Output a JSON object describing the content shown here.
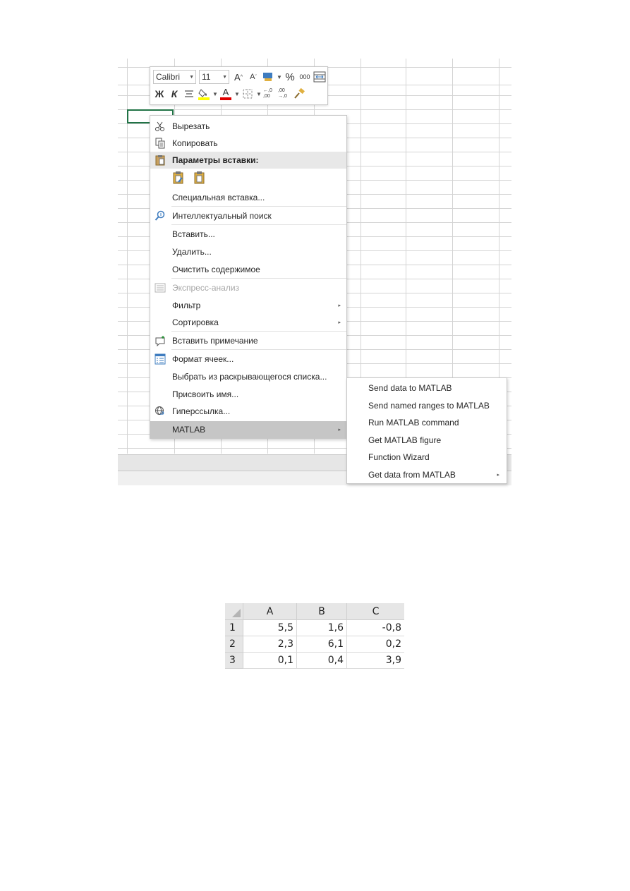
{
  "mini_toolbar": {
    "font_name": "Calibri",
    "font_size": "11",
    "grow_font": "A",
    "shrink_font": "A",
    "percent": "%",
    "thousands": "000",
    "bold": "Ж",
    "italic": "К",
    "font_color_letter": "A",
    "inc_decimal": "←,0 ,00",
    "dec_decimal": ",00 →,0",
    "icons": [
      "font-grow-icon",
      "font-shrink-icon",
      "accounting-format-icon",
      "percent-icon",
      "comma-style-icon",
      "merge-center-icon",
      "bold-icon",
      "italic-icon",
      "align-center-icon",
      "fill-color-icon",
      "font-color-icon",
      "borders-icon",
      "increase-decimal-icon",
      "decrease-decimal-icon",
      "format-painter-icon"
    ],
    "colors": {
      "fill_color": "#ffff00",
      "font_color": "#e00000"
    }
  },
  "context_menu": {
    "cut": "Вырезать",
    "copy": "Копировать",
    "paste_options": "Параметры вставки:",
    "paste_special": "Специальная вставка...",
    "smart_lookup": "Интеллектуальный поиск",
    "insert": "Вставить...",
    "delete": "Удалить...",
    "clear_contents": "Очистить содержимое",
    "quick_analysis": "Экспресс-анализ",
    "filter": "Фильтр",
    "sort": "Сортировка",
    "insert_comment": "Вставить примечание",
    "format_cells": "Формат ячеек...",
    "pick_from_list": "Выбрать из раскрывающегося списка...",
    "define_name": "Присвоить имя...",
    "hyperlink": "Гиперссылка...",
    "matlab": "MATLAB",
    "submenu_arrow": "▸"
  },
  "matlab_submenu": {
    "send_data": "Send data to MATLAB",
    "send_named_ranges": "Send named ranges to MATLAB",
    "run_command": "Run MATLAB command",
    "get_figure": "Get MATLAB figure",
    "function_wizard": "Function Wizard",
    "get_data": "Get data from MATLAB"
  },
  "data_table": {
    "columns": [
      "A",
      "B",
      "C"
    ],
    "rows": [
      {
        "label": "1",
        "values": [
          "5,5",
          "1,6",
          "-0,8"
        ]
      },
      {
        "label": "2",
        "values": [
          "2,3",
          "6,1",
          "0,2"
        ]
      },
      {
        "label": "3",
        "values": [
          "0,1",
          "0,4",
          "3,9"
        ]
      }
    ]
  },
  "colors": {
    "selection_border": "#217346",
    "menu_highlight": "#c6c6c6",
    "header_bg": "#e6e6e6"
  }
}
